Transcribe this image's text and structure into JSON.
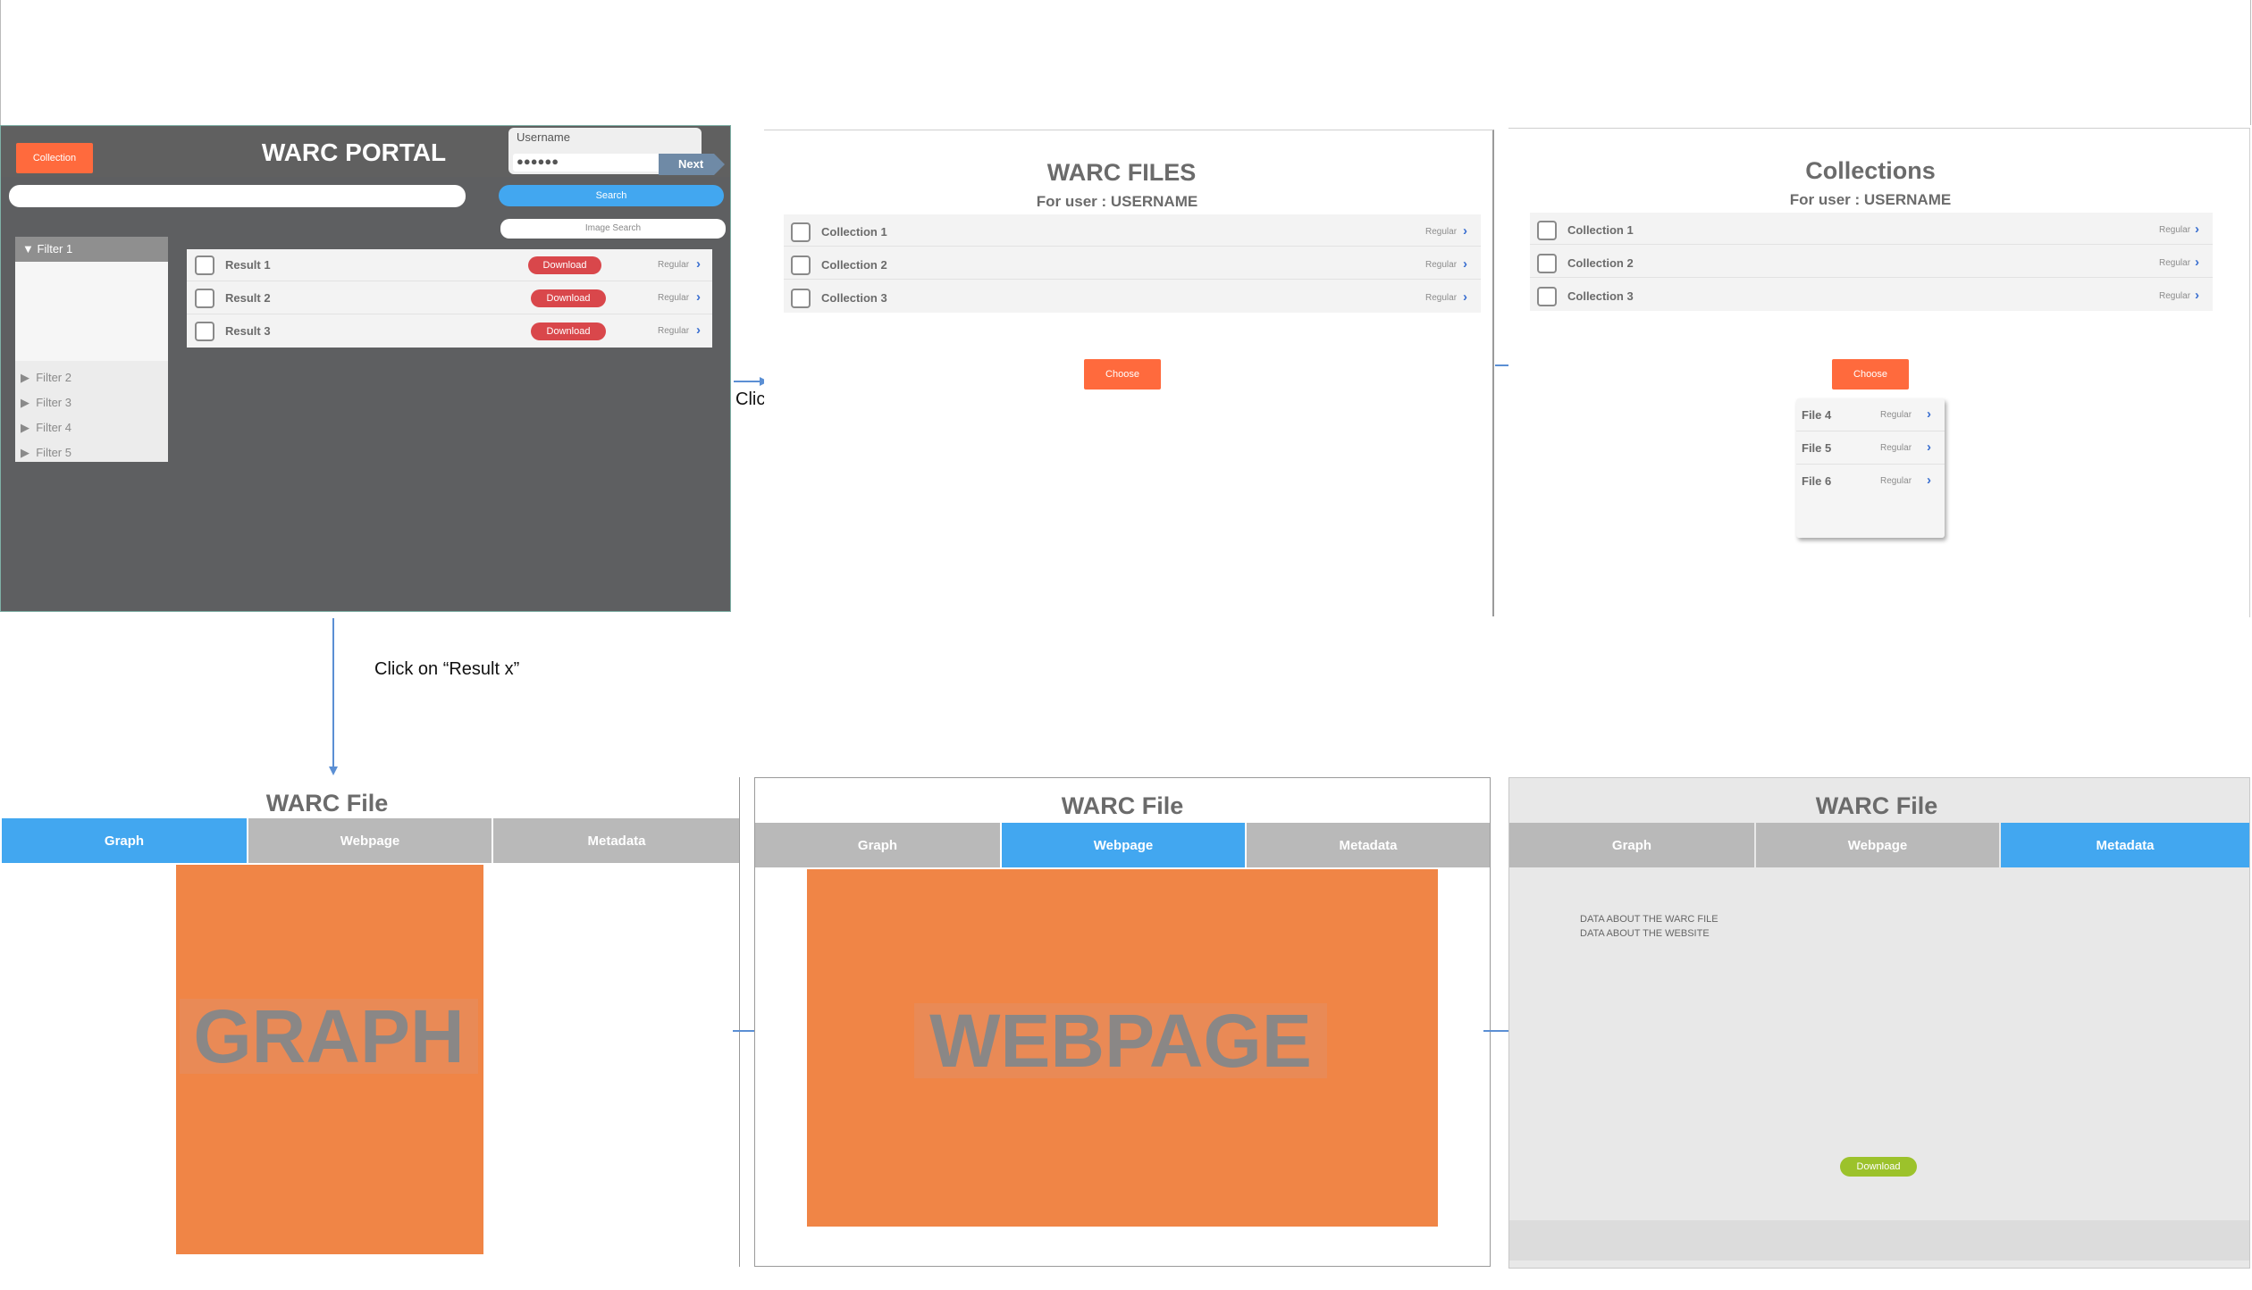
{
  "colors": {
    "dark_panel": "#5e5f61",
    "header": "#606060",
    "orange": "#ff6a3d",
    "orange_block": "#f08546",
    "blue": "#42a7f0",
    "red": "#d9474b",
    "green": "#9cc22b",
    "gray_tab": "#b9b9b9",
    "arrow": "#5b8fd4"
  },
  "portal": {
    "collection_btn": "Collection",
    "title": "WARC PORTAL",
    "username_label": "Username",
    "password_mask": "●●●●●●",
    "next_btn": "Next",
    "search_btn": "Search",
    "image_search_btn": "Image Search",
    "filters": [
      "Filter 1",
      "Filter 2",
      "Filter 3",
      "Filter 4",
      "Filter 5"
    ],
    "results": [
      {
        "label": "Result 1",
        "download": "Download",
        "type": "Regular"
      },
      {
        "label": "Result 2",
        "download": "Download",
        "type": "Regular"
      },
      {
        "label": "Result 3",
        "download": "Download",
        "type": "Regular"
      }
    ]
  },
  "warc_files": {
    "title": "WARC FILES",
    "subtitle": "For user : USERNAME",
    "rows": [
      {
        "label": "Collection 1",
        "type": "Regular"
      },
      {
        "label": "Collection 2",
        "type": "Regular"
      },
      {
        "label": "Collection 3",
        "type": "Regular"
      }
    ],
    "choose_btn": "Choose"
  },
  "collections": {
    "title": "Collections",
    "subtitle": "For user : USERNAME",
    "rows": [
      {
        "label": "Collection 1",
        "type": "Regular"
      },
      {
        "label": "Collection 2",
        "type": "Regular"
      },
      {
        "label": "Collection 3",
        "type": "Regular"
      }
    ],
    "choose_btn": "Choose",
    "popup": [
      {
        "label": "File 4",
        "type": "Regular"
      },
      {
        "label": "File 5",
        "type": "Regular"
      },
      {
        "label": "File 6",
        "type": "Regular"
      }
    ]
  },
  "annotations": {
    "click_collection": "Click on “Collection”",
    "click_result": "Click on “Result x”"
  },
  "warc_file_views": {
    "title": "WARC File",
    "tabs": [
      "Graph",
      "Webpage",
      "Metadata"
    ],
    "graph_text": "GRAPH",
    "webpage_text": "WEBPAGE",
    "metadata_lines": [
      "DATA ABOUT THE WARC FILE",
      "DATA ABOUT THE WEBSITE"
    ],
    "download_btn": "Download"
  }
}
